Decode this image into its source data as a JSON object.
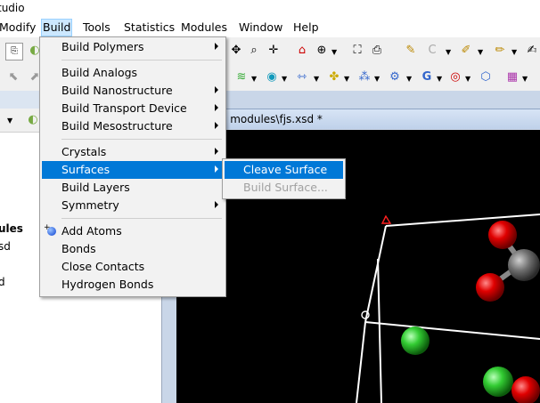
{
  "window": {
    "title_fragment": "tudio"
  },
  "menubar": {
    "items": [
      {
        "label": "Modify"
      },
      {
        "label": "Build"
      },
      {
        "label": "Tools"
      },
      {
        "label": "Statistics"
      },
      {
        "label": "Modules"
      },
      {
        "label": "Window"
      },
      {
        "label": "Help"
      }
    ],
    "active": "Build"
  },
  "left_panel": {
    "texts": [
      "ules",
      "sd",
      "d"
    ]
  },
  "document": {
    "tab_title": "tal modules\\fjs.xsd *"
  },
  "build_menu": {
    "items": [
      {
        "label": "Build Polymers",
        "submenu": true
      },
      {
        "label": "Build Analogs",
        "submenu": false
      },
      {
        "label": "Build Nanostructure",
        "submenu": true
      },
      {
        "label": "Build Transport Device",
        "submenu": true
      },
      {
        "label": "Build Mesostructure",
        "submenu": true
      },
      {
        "label": "Crystals",
        "submenu": true
      },
      {
        "label": "Surfaces",
        "submenu": true,
        "highlighted": true
      },
      {
        "label": "Build Layers",
        "submenu": false
      },
      {
        "label": "Symmetry",
        "submenu": true
      },
      {
        "label": "Add Atoms",
        "submenu": false,
        "icon": "add-atoms-icon"
      },
      {
        "label": "Bonds",
        "submenu": false
      },
      {
        "label": "Close Contacts",
        "submenu": false
      },
      {
        "label": "Hydrogen Bonds",
        "submenu": false
      }
    ]
  },
  "surfaces_submenu": {
    "items": [
      {
        "label": "Cleave Surface",
        "highlighted": true,
        "enabled": true
      },
      {
        "label": "Build Surface...",
        "enabled": false
      }
    ]
  },
  "colors": {
    "highlight": "#0078d7",
    "viewport_bg": "#000000",
    "atom_oxygen": "#e00000",
    "atom_chlorine": "#33cc33",
    "atom_carbon": "#707070",
    "cell_edges": "#ffffff",
    "origin_marker": "#ff0000"
  },
  "toolbar_icons": {
    "row1": [
      "open-icon",
      "snap-icon",
      "zoom-icon",
      "pan-icon",
      "home-icon",
      "rotate-icon",
      "fit-icon",
      "export-icon",
      "pencil-icon",
      "color-icon",
      "paint-icon",
      "brush-icon",
      "edit-icon"
    ],
    "row2": [
      "select-icon",
      "arrow-icon",
      "curve-icon",
      "cycle-icon",
      "arrows-icon",
      "cluster-icon",
      "grid-icon",
      "gear-icon",
      "target-icon",
      "cube-icon",
      "bars-icon"
    ]
  }
}
